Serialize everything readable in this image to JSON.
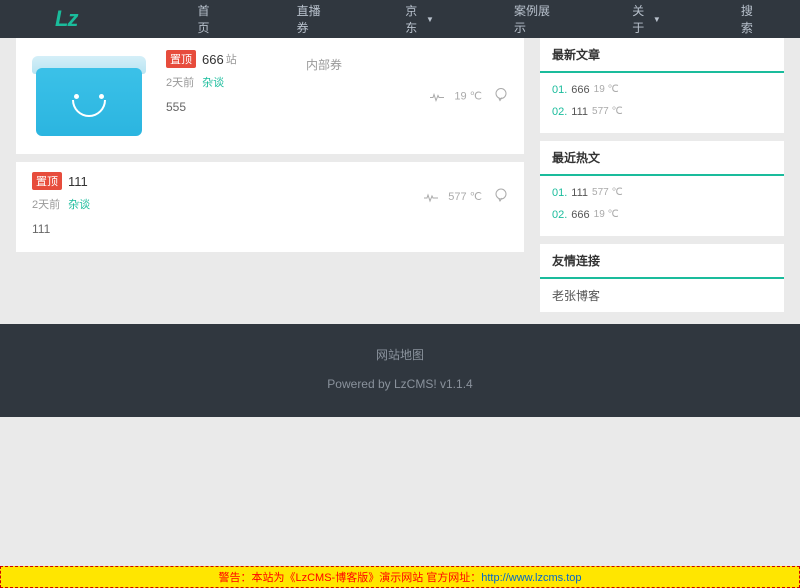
{
  "header": {
    "logo": "Lz",
    "nav": [
      {
        "label": "首页",
        "has_dropdown": false
      },
      {
        "label": "直播券",
        "has_dropdown": false
      },
      {
        "label": "京东",
        "has_dropdown": true
      },
      {
        "label": "案例展示",
        "has_dropdown": false
      },
      {
        "label": "关于",
        "has_dropdown": true
      },
      {
        "label": "搜索",
        "has_dropdown": false
      }
    ]
  },
  "posts": [
    {
      "badge": "置顶",
      "title": "666",
      "suffix": "站",
      "time": "2天前",
      "category": "杂谈",
      "excerpt": "555",
      "extra": "内部券",
      "temp": "19 ℃"
    },
    {
      "badge": "置顶",
      "title": "111",
      "time": "2天前",
      "category": "杂谈",
      "excerpt": "111",
      "temp": "577 ℃"
    }
  ],
  "sidebar": {
    "latest": {
      "title": "最新文章",
      "items": [
        {
          "num": "01.",
          "title": "666",
          "temp": "19 ℃"
        },
        {
          "num": "02.",
          "title": "111",
          "temp": "577 ℃"
        }
      ]
    },
    "hot": {
      "title": "最近热文",
      "items": [
        {
          "num": "01.",
          "title": "111",
          "temp": "577 ℃"
        },
        {
          "num": "02.",
          "title": "666",
          "temp": "19 ℃"
        }
      ]
    },
    "links": {
      "title": "友情连接",
      "items": [
        "老张博客"
      ]
    }
  },
  "footer": {
    "sitemap": "网站地图",
    "powered": "Powered by LzCMS! v1.1.4"
  },
  "banner": {
    "prefix": "警告：本站为《LzCMS-博客版》演示网站 官方网址：",
    "url": "http://www.lzcms.top"
  }
}
